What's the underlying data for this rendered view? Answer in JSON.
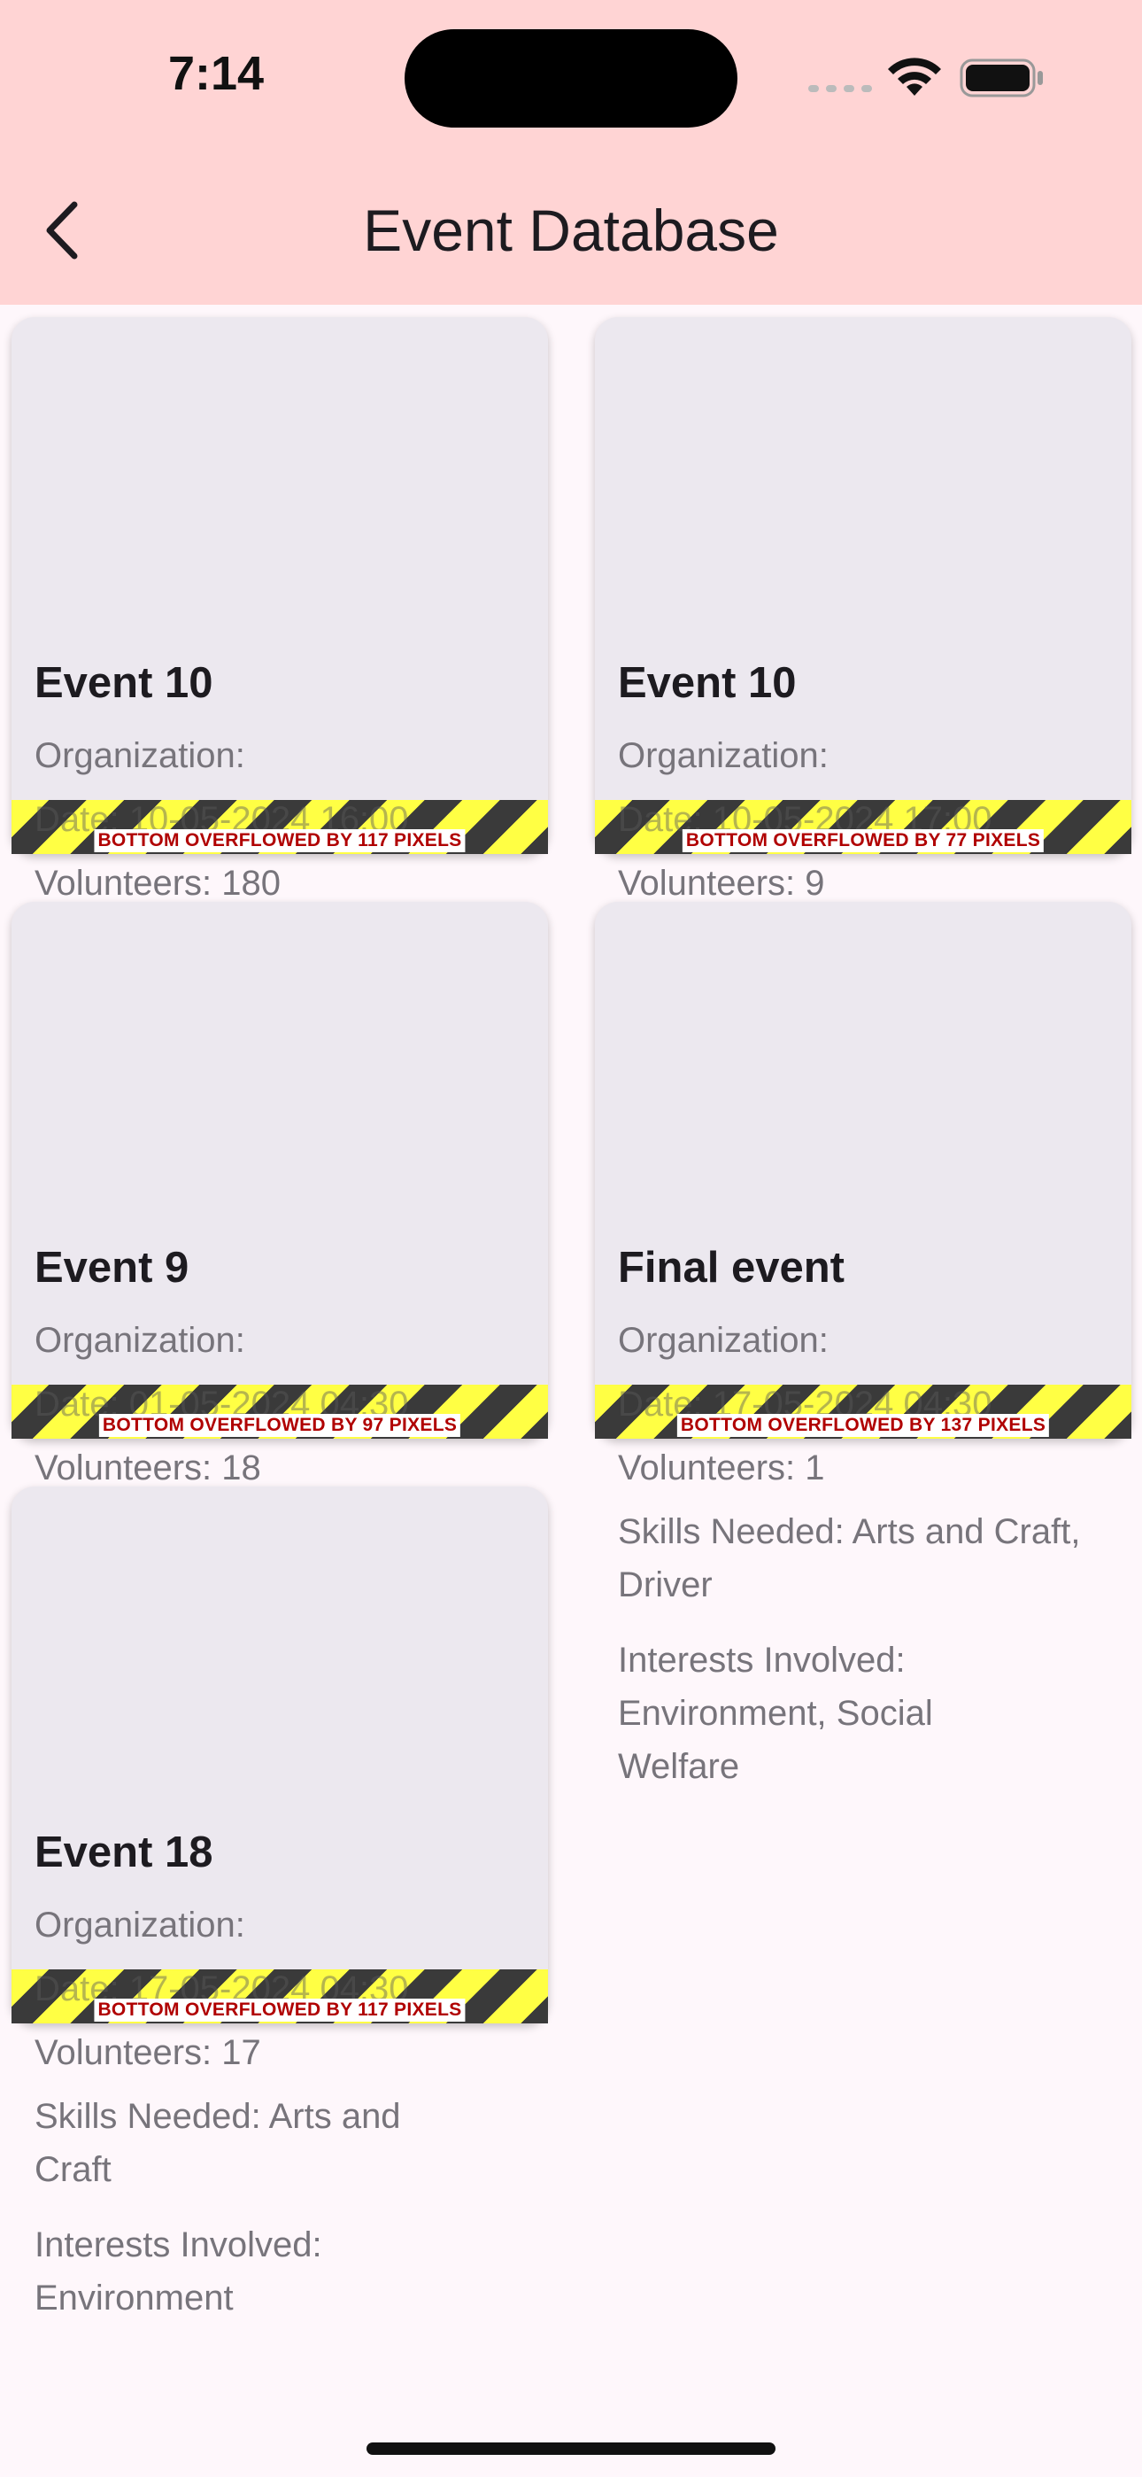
{
  "status": {
    "time": "7:14"
  },
  "header": {
    "title": "Event Database"
  },
  "overflow_colors": {
    "stripe_yellow": "#ffff44",
    "stripe_dark": "#3a3a3a",
    "label_red": "#b00000"
  },
  "events": [
    {
      "title": "Event 10",
      "organization": "Organization:",
      "date": "Date: 10-05-2024 16:00",
      "overflow": "BOTTOM OVERFLOWED BY 117 PIXELS",
      "volunteers": "Volunteers: 180"
    },
    {
      "title": "Event 10",
      "organization": "Organization:",
      "date": "Date: 10-05-2024 17:00",
      "overflow": "BOTTOM OVERFLOWED BY 77 PIXELS",
      "volunteers": "Volunteers: 9"
    },
    {
      "title": "Event 9",
      "organization": "Organization:",
      "date": "Date: 01-05-2024 04:30",
      "overflow": "BOTTOM OVERFLOWED BY 97 PIXELS",
      "volunteers": "Volunteers: 18"
    },
    {
      "title": "Final event",
      "organization": "Organization:",
      "date": "Date: 17-05-2024 04:30",
      "overflow": "BOTTOM OVERFLOWED BY 137 PIXELS",
      "volunteers": "Volunteers: 1",
      "skills": "Skills Needed: Arts and Craft, Driver",
      "interests": "Interests Involved: Environment, Social Welfare"
    },
    {
      "title": "Event 18",
      "organization": "Organization:",
      "date": "Date: 17-05-2024 04:30",
      "overflow": "BOTTOM OVERFLOWED BY 117 PIXELS",
      "volunteers": "Volunteers: 17",
      "skills": "Skills Needed: Arts and Craft",
      "interests": "Interests Involved: Environment"
    }
  ]
}
